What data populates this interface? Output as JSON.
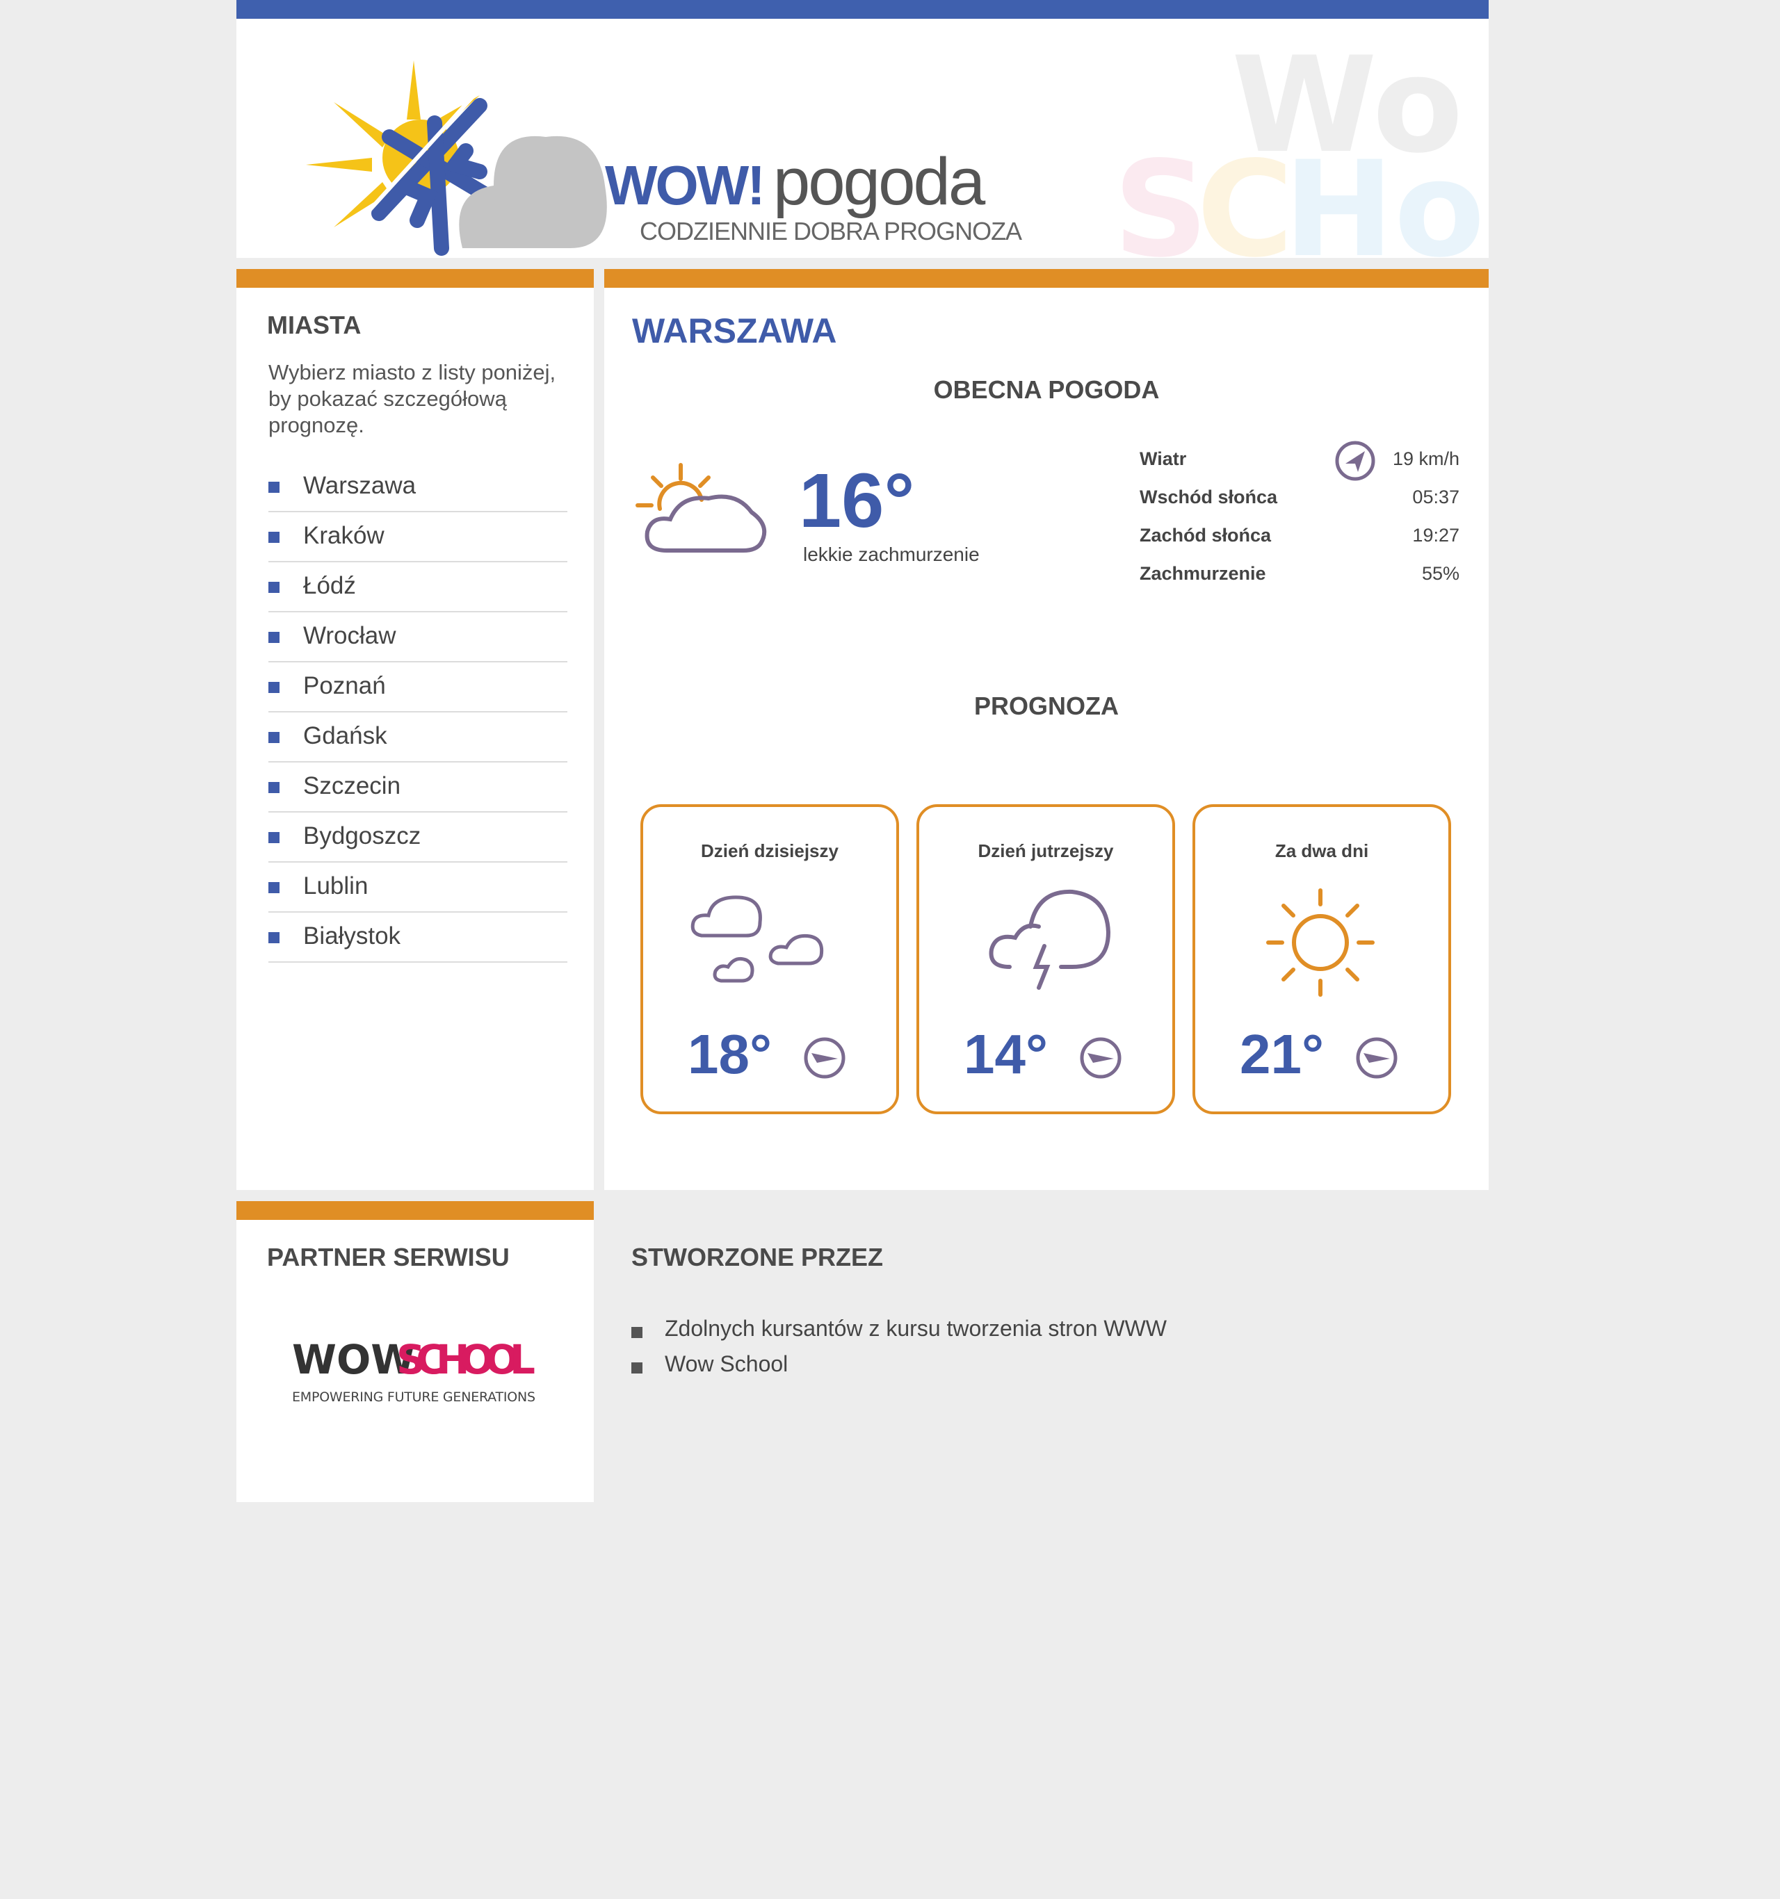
{
  "header": {
    "brand_wow": "WOW!",
    "brand_pogoda": "pogoda",
    "tagline": "CODZIENNIE DOBRA PROGNOZA",
    "watermark_text": "Wow School"
  },
  "sidebar": {
    "title": "MIASTA",
    "intro": "Wybierz miasto z listy poniżej, by pokazać szczegółową prognozę.",
    "cities": [
      "Warszawa",
      "Kraków",
      "Łódź",
      "Wrocław",
      "Poznań",
      "Gdańsk",
      "Szczecin",
      "Bydgoszcz",
      "Lublin",
      "Białystok"
    ]
  },
  "main": {
    "city": "WARSZAWA",
    "current_title": "OBECNA POGODA",
    "current": {
      "icon": "partly-cloudy-icon",
      "temperature": "16°",
      "description": "lekkie zachmurzenie",
      "details": [
        {
          "label": "Wiatr",
          "value": "19 km/h",
          "icon": "wind-direction-icon"
        },
        {
          "label": "Wschód słońca",
          "value": "05:37"
        },
        {
          "label": "Zachód słońca",
          "value": "19:27"
        },
        {
          "label": "Zachmurzenie",
          "value": "55%"
        }
      ]
    },
    "forecast_title": "PROGNOZA",
    "forecast": [
      {
        "title": "Dzień dzisiejszy",
        "icon": "clouds-icon",
        "temperature": "18°"
      },
      {
        "title": "Dzień jutrzejszy",
        "icon": "storm-icon",
        "temperature": "14°"
      },
      {
        "title": "Za dwa dni",
        "icon": "sun-icon",
        "temperature": "21°"
      }
    ]
  },
  "partner": {
    "title": "PARTNER SERWISU",
    "logo_wow": "WOW",
    "logo_school": "SCHOOL",
    "logo_tagline": "EMPOWERING FUTURE GENERATIONS"
  },
  "credits": {
    "title": "STWORZONE PRZEZ",
    "items": [
      "Zdolnych kursantów z kursu tworzenia stron WWW",
      "Wow School"
    ]
  },
  "colors": {
    "accent_blue": "#3f5ba9",
    "accent_orange": "#e08e25",
    "icon_purple": "#7a6a8f",
    "background": "#ededed"
  }
}
